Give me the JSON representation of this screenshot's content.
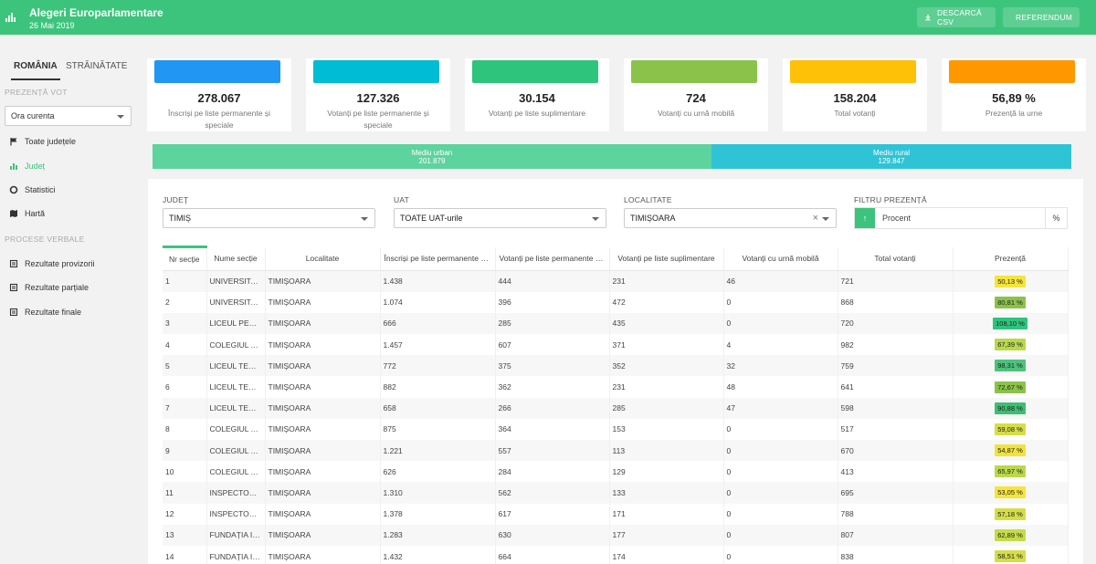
{
  "header": {
    "title": "Alegeri Europarlamentare",
    "date": "26 Mai 2019",
    "csv_button": "DESCARCĂ CSV",
    "referendum_button": "REFERENDUM"
  },
  "sidebar": {
    "tabs": [
      "ROMÂNIA",
      "STRĂINĂTATE"
    ],
    "prezenta_label": "PREZENȚĂ VOT",
    "ora_select": "Ora curenta",
    "nav": [
      "Toate județele",
      "Județ",
      "Statistici",
      "Hartă"
    ],
    "procese_label": "PROCESE VERBALE",
    "procese": [
      "Rezultate provizorii",
      "Rezultate parțiale",
      "Rezultate finale"
    ]
  },
  "cards": [
    {
      "value": "278.067",
      "label": "Înscriși pe liste permanente și speciale",
      "color": "#2196f3"
    },
    {
      "value": "127.326",
      "label": "Votanți pe liste permanente și speciale",
      "color": "#00bcd4"
    },
    {
      "value": "30.154",
      "label": "Votanți pe liste suplimentare",
      "color": "#2ec47c"
    },
    {
      "value": "724",
      "label": "Votanți cu urnă mobilă",
      "color": "#8bc34a"
    },
    {
      "value": "158.204",
      "label": "Total votanți",
      "color": "#ffc107"
    },
    {
      "value": "56,89 %",
      "label": "Prezență la urne",
      "color": "#ff9800"
    }
  ],
  "mediu": {
    "urban_label": "Mediu urban",
    "urban_value": "201.879",
    "urban_share": 0.6088,
    "rural_label": "Mediu rural",
    "rural_value": "129.847"
  },
  "filters": {
    "judet_label": "JUDEȚ",
    "judet_value": "TIMIȘ",
    "uat_label": "UAT",
    "uat_value": "TOATE UAT-urile",
    "localitate_label": "LOCALITATE",
    "localitate_value": "TIMIȘOARA",
    "filtru_label": "FILTRU PREZENȚĂ",
    "filtru_value": "Procent",
    "filtru_unit": "%"
  },
  "table": {
    "headers": [
      "Nr secție",
      "Nume secție",
      "Localitate",
      "Înscriși pe liste permanente și speciale",
      "Votanți pe liste permanente și speciale",
      "Votanți pe liste suplimentare",
      "Votanți cu urnă mobilă",
      "Total votanți",
      "Prezență"
    ],
    "rows": [
      [
        "1",
        "UNIVERSITATEA DE VEST",
        "TIMIȘOARA",
        "1.438",
        "444",
        "231",
        "46",
        "721",
        "50,13 %"
      ],
      [
        "2",
        "UNIVERSITATEA DE VEST",
        "TIMIȘOARA",
        "1.074",
        "396",
        "472",
        "0",
        "868",
        "80,81 %"
      ],
      [
        "3",
        "LICEUL PEDAGOGIC",
        "TIMIȘOARA",
        "666",
        "285",
        "435",
        "0",
        "720",
        "108,10 %"
      ],
      [
        "4",
        "COLEGIUL TEHNIC",
        "TIMIȘOARA",
        "1.457",
        "607",
        "371",
        "4",
        "982",
        "67,39 %"
      ],
      [
        "5",
        "LICEUL TEORETIC",
        "TIMIȘOARA",
        "772",
        "375",
        "352",
        "32",
        "759",
        "98,31 %"
      ],
      [
        "6",
        "LICEUL TEORETIC",
        "TIMIȘOARA",
        "882",
        "362",
        "231",
        "48",
        "641",
        "72,67 %"
      ],
      [
        "7",
        "LICEUL TEORETIC",
        "TIMIȘOARA",
        "658",
        "266",
        "285",
        "47",
        "598",
        "90,88 %"
      ],
      [
        "8",
        "COLEGIUL TEHNIC",
        "TIMIȘOARA",
        "875",
        "364",
        "153",
        "0",
        "517",
        "59,08 %"
      ],
      [
        "9",
        "COLEGIUL TEHNIC",
        "TIMIȘOARA",
        "1.221",
        "557",
        "113",
        "0",
        "670",
        "54,87 %"
      ],
      [
        "10",
        "COLEGIUL TEHNIC",
        "TIMIȘOARA",
        "626",
        "284",
        "129",
        "0",
        "413",
        "65,97 %"
      ],
      [
        "11",
        "INSPECTORATUL",
        "TIMIȘOARA",
        "1.310",
        "562",
        "133",
        "0",
        "695",
        "53,05 %"
      ],
      [
        "12",
        "INSPECTORATUL",
        "TIMIȘOARA",
        "1.378",
        "617",
        "171",
        "0",
        "788",
        "57,18 %"
      ],
      [
        "13",
        "FUNDAȚIA IOAN",
        "TIMIȘOARA",
        "1.283",
        "630",
        "177",
        "0",
        "807",
        "62,89 %"
      ],
      [
        "14",
        "FUNDAȚIA IOAN",
        "TIMIȘOARA",
        "1.432",
        "664",
        "174",
        "0",
        "838",
        "58,51 %"
      ]
    ],
    "badge_colors": [
      "#f5e53a",
      "#8bc34a",
      "#2ec47c",
      "#b9d94a",
      "#4cc27a",
      "#8bc34a",
      "#3cbf72",
      "#d5de45",
      "#f0e33c",
      "#b9d94a",
      "#f5e53a",
      "#d5de45",
      "#c6db48",
      "#d5de45"
    ]
  }
}
